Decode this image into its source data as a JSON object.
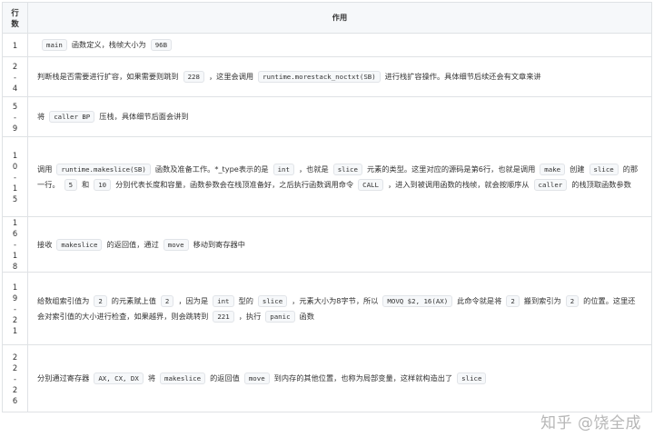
{
  "header": {
    "line": "行数",
    "desc": "作用"
  },
  "rows": [
    {
      "line": "1",
      "parts": [
        {
          "code": "main"
        },
        {
          "text": "函数定义，栈帧大小为"
        },
        {
          "code": "96B"
        }
      ]
    },
    {
      "line": "2-4",
      "parts": [
        {
          "text": "判断栈是否需要进行扩容，如果需要则跳到"
        },
        {
          "code": "228"
        },
        {
          "text": "，这里会调用"
        },
        {
          "code": "runtime.morestack_noctxt(SB)"
        },
        {
          "text": "进行栈扩容操作。具体细节后续还会有文章来讲"
        }
      ]
    },
    {
      "line": "5-9",
      "parts": [
        {
          "text": "将"
        },
        {
          "code": "caller BP"
        },
        {
          "text": "压栈，具体细节后面会讲到"
        }
      ]
    },
    {
      "line": "10-15",
      "parts": [
        {
          "text": "调用"
        },
        {
          "code": "runtime.makeslice(SB)"
        },
        {
          "text": "函数及准备工作。*_type表示的是"
        },
        {
          "code": "int"
        },
        {
          "text": "，也就是"
        },
        {
          "code": "slice"
        },
        {
          "text": "元素的类型。这里对应的源码是第6行，也就是调用"
        },
        {
          "code": "make"
        },
        {
          "text": "创建"
        },
        {
          "code": "slice"
        },
        {
          "text": "的那一行。"
        },
        {
          "code": "5"
        },
        {
          "text": "和"
        },
        {
          "code": "10"
        },
        {
          "text": "分别代表长度和容量，函数参数会在栈顶准备好，之后执行函数调用命令"
        },
        {
          "code": "CALL"
        },
        {
          "text": "，进入到被调用函数的栈帧，就会按顺序从"
        },
        {
          "code": "caller"
        },
        {
          "text": "的栈顶取函数参数"
        }
      ]
    },
    {
      "line": "16-18",
      "parts": [
        {
          "text": "接收"
        },
        {
          "code": "makeslice"
        },
        {
          "text": "的返回值，通过"
        },
        {
          "code": "move"
        },
        {
          "text": "移动到寄存器中"
        }
      ]
    },
    {
      "line": "19-21",
      "parts": [
        {
          "text": "给数组索引值为"
        },
        {
          "code": "2"
        },
        {
          "text": "的元素赋上值"
        },
        {
          "code": "2"
        },
        {
          "text": "，因为是"
        },
        {
          "code": "int"
        },
        {
          "text": "型的"
        },
        {
          "code": "slice"
        },
        {
          "text": "，元素大小为8字节，所以"
        },
        {
          "code": "MOVQ $2, 16(AX)"
        },
        {
          "text": "此命令就是将"
        },
        {
          "code": "2"
        },
        {
          "text": "搬到索引为"
        },
        {
          "code": "2"
        },
        {
          "text": "的位置。这里还会对索引值的大小进行检查，如果越界，则会跳转到"
        },
        {
          "code": "221"
        },
        {
          "text": "，执行"
        },
        {
          "code": "panic"
        },
        {
          "text": "函数"
        }
      ]
    },
    {
      "line": "22-26",
      "parts": [
        {
          "text": "分别通过寄存器"
        },
        {
          "code": "AX, CX, DX"
        },
        {
          "text": "将"
        },
        {
          "code": "makeslice"
        },
        {
          "text": "的返回值"
        },
        {
          "code": "move"
        },
        {
          "text": "到内存的其他位置，也称为局部变量，这样就构造出了"
        },
        {
          "code": "slice"
        }
      ]
    }
  ],
  "watermark": "知乎 @饶全成"
}
